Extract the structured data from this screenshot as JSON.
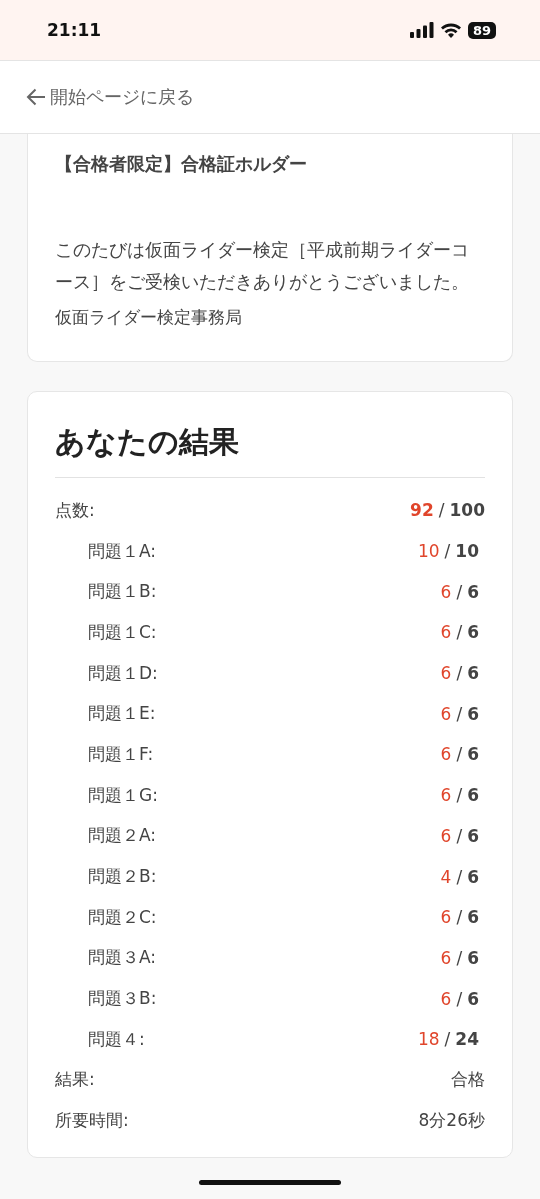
{
  "status_bar": {
    "time": "21:11",
    "battery": "89"
  },
  "header": {
    "back_link": "開始ページに戻る"
  },
  "notice_card": {
    "title": "【合格者限定】合格証ホルダー",
    "message": "このたびは仮面ライダー検定［平成前期ライダーコース］をご受検いただきありがとうございました。",
    "signature": "仮面ライダー検定事務局"
  },
  "results": {
    "heading": "あなたの結果",
    "total": {
      "label": "点数:",
      "score": "92",
      "separator": "/",
      "max": "100"
    },
    "questions": [
      {
        "label": "問題１A:",
        "score": "10",
        "separator": "/",
        "max": "10"
      },
      {
        "label": "問題１B:",
        "score": "6",
        "separator": "/",
        "max": "6"
      },
      {
        "label": "問題１C:",
        "score": "6",
        "separator": "/",
        "max": "6"
      },
      {
        "label": "問題１D:",
        "score": "6",
        "separator": "/",
        "max": "6"
      },
      {
        "label": "問題１E:",
        "score": "6",
        "separator": "/",
        "max": "6"
      },
      {
        "label": "問題１F:",
        "score": "6",
        "separator": "/",
        "max": "6"
      },
      {
        "label": "問題１G:",
        "score": "6",
        "separator": "/",
        "max": "6"
      },
      {
        "label": "問題２A:",
        "score": "6",
        "separator": "/",
        "max": "6"
      },
      {
        "label": "問題２B:",
        "score": "4",
        "separator": "/",
        "max": "6"
      },
      {
        "label": "問題２C:",
        "score": "6",
        "separator": "/",
        "max": "6"
      },
      {
        "label": "問題３A:",
        "score": "6",
        "separator": "/",
        "max": "6"
      },
      {
        "label": "問題３B:",
        "score": "6",
        "separator": "/",
        "max": "6"
      },
      {
        "label": "問題４:",
        "score": "18",
        "separator": "/",
        "max": "24"
      }
    ],
    "summary": [
      {
        "label": "結果:",
        "value": "合格"
      },
      {
        "label": "所要時間:",
        "value": "8分26秒"
      }
    ]
  }
}
